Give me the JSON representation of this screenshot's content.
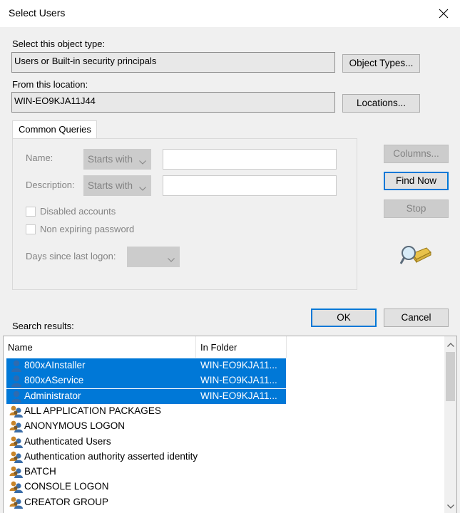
{
  "window": {
    "title": "Select Users"
  },
  "object_type": {
    "label": "Select this object type:",
    "value": "Users or Built-in security principals",
    "button": "Object Types..."
  },
  "location": {
    "label": "From this location:",
    "value": "WIN-EO9KJA11J44",
    "button": "Locations..."
  },
  "queries": {
    "tab": "Common Queries",
    "name_label": "Name:",
    "name_mode": "Starts with",
    "description_label": "Description:",
    "description_mode": "Starts with",
    "disabled_accounts": "Disabled accounts",
    "non_expiring_password": "Non expiring password",
    "days_label": "Days since last logon:"
  },
  "buttons": {
    "columns": "Columns...",
    "find_now": "Find Now",
    "stop": "Stop",
    "ok": "OK",
    "cancel": "Cancel"
  },
  "results": {
    "label": "Search results:",
    "columns": [
      "Name",
      "In Folder"
    ],
    "rows": [
      {
        "name": "800xAInstaller",
        "folder": "WIN-EO9KJA11...",
        "selected": true,
        "icon": "user-icon"
      },
      {
        "name": "800xAService",
        "folder": "WIN-EO9KJA11...",
        "selected": true,
        "icon": "user-icon"
      },
      {
        "name": "Administrator",
        "folder": "WIN-EO9KJA11...",
        "selected": true,
        "icon": "user-icon"
      },
      {
        "name": "ALL APPLICATION PACKAGES",
        "folder": "",
        "selected": false,
        "icon": "group-icon"
      },
      {
        "name": "ANONYMOUS LOGON",
        "folder": "",
        "selected": false,
        "icon": "group-icon"
      },
      {
        "name": "Authenticated Users",
        "folder": "",
        "selected": false,
        "icon": "group-icon"
      },
      {
        "name": "Authentication authority asserted identity",
        "folder": "",
        "selected": false,
        "icon": "group-icon"
      },
      {
        "name": "BATCH",
        "folder": "",
        "selected": false,
        "icon": "group-icon"
      },
      {
        "name": "CONSOLE LOGON",
        "folder": "",
        "selected": false,
        "icon": "group-icon"
      },
      {
        "name": "CREATOR GROUP",
        "folder": "",
        "selected": false,
        "icon": "group-icon"
      }
    ]
  },
  "colors": {
    "selection": "#0078d7",
    "dialog_bg": "#f0f0f0",
    "user_icon": "#2e6bb0",
    "group_icon": "#c8852a"
  }
}
